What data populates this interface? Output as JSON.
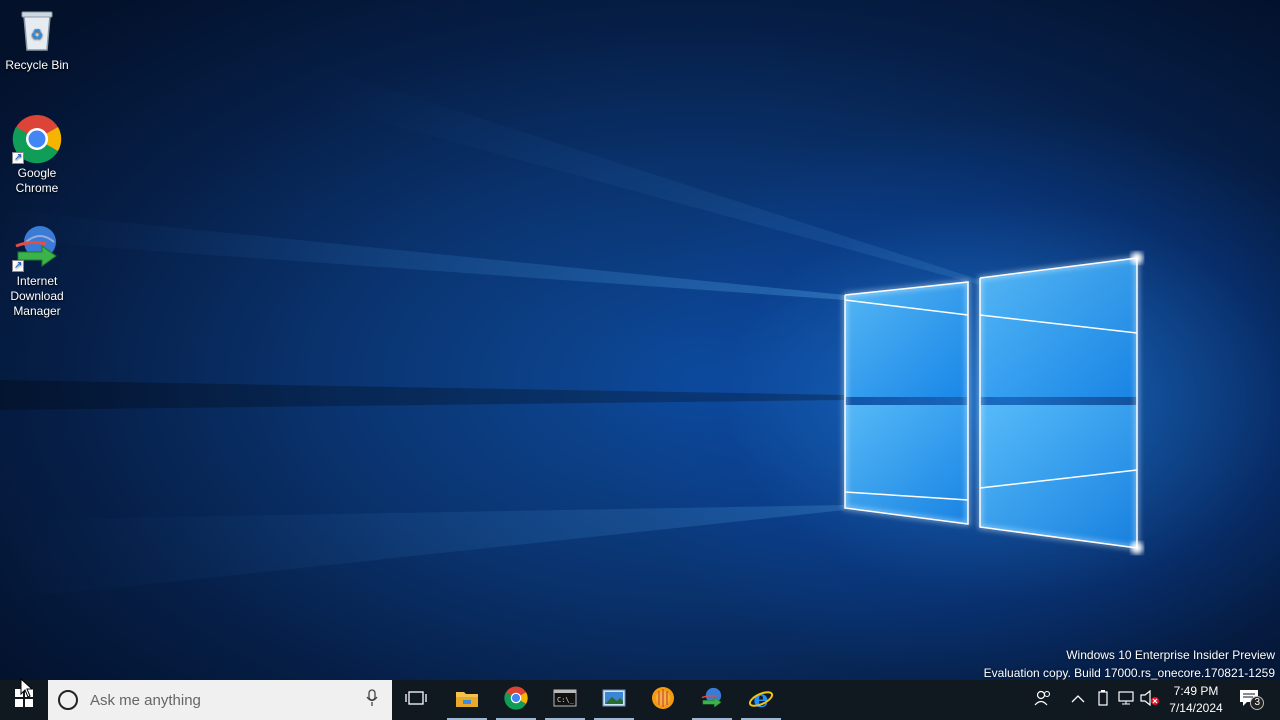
{
  "desktop": {
    "icons": [
      {
        "label": "Recycle Bin"
      },
      {
        "label": "Google Chrome"
      },
      {
        "label": "Internet Download Manager"
      }
    ],
    "watermark": {
      "line1": "Windows 10 Enterprise Insider Preview",
      "line2": "Evaluation copy. Build 17000.rs_onecore.170821-1259"
    }
  },
  "taskbar": {
    "search_placeholder": "Ask me anything",
    "pinned": [
      "file-explorer-icon",
      "chrome-icon",
      "command-prompt-icon",
      "photo-viewer-icon",
      "media-player-icon",
      "internet-download-manager-icon",
      "internet-explorer-icon"
    ],
    "clock": {
      "time": "7:49 PM",
      "date": "7/14/2024"
    },
    "notifications_count": "3"
  },
  "colors": {
    "taskbar_bg": "#101820",
    "accent": "#1e90ff"
  }
}
